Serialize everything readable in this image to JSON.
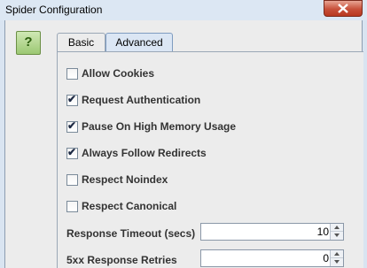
{
  "window": {
    "title": "Spider Configuration"
  },
  "help_button": {
    "label": "?"
  },
  "tabs": [
    {
      "label": "Basic",
      "selected": false
    },
    {
      "label": "Advanced",
      "selected": true
    }
  ],
  "options": [
    {
      "label": "Allow Cookies",
      "checked": false
    },
    {
      "label": "Request Authentication",
      "checked": true
    },
    {
      "label": "Pause On High Memory Usage",
      "checked": true
    },
    {
      "label": "Always Follow Redirects",
      "checked": true
    },
    {
      "label": "Respect Noindex",
      "checked": false
    },
    {
      "label": "Respect Canonical",
      "checked": false
    }
  ],
  "fields": [
    {
      "label": "Response Timeout (secs)",
      "value": "10"
    },
    {
      "label": "5xx Response Retries",
      "value": "0"
    }
  ],
  "check_mark": "✔",
  "colors": {
    "close_button": "#c7503a",
    "selected_tab": "#dbe6f4",
    "help_button": "#9cc873"
  }
}
